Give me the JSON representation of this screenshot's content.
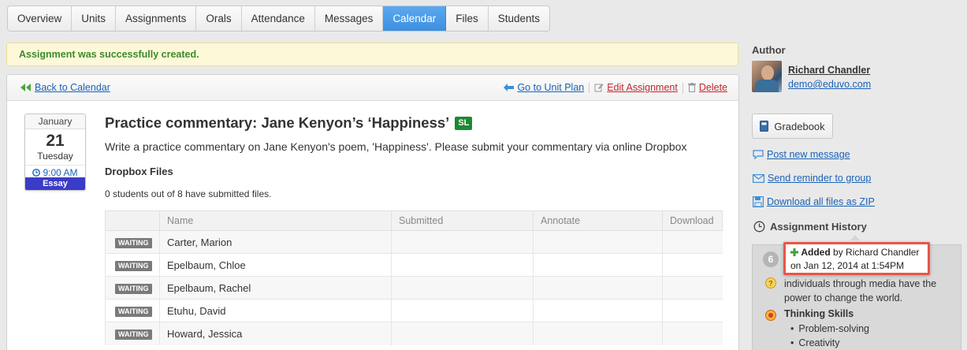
{
  "tabs": [
    "Overview",
    "Units",
    "Assignments",
    "Orals",
    "Attendance",
    "Messages",
    "Calendar",
    "Files",
    "Students"
  ],
  "active_tab": "Calendar",
  "flash": "Assignment was successfully created.",
  "panel": {
    "back_label": "Back to Calendar",
    "go_unit_plan": "Go to Unit Plan",
    "edit_assignment": "Edit Assignment",
    "delete": "Delete"
  },
  "calendar": {
    "month": "January",
    "day": "21",
    "weekday": "Tuesday",
    "time": "9:00 AM",
    "type": "Essay"
  },
  "assignment": {
    "title": "Practice commentary: Jane Kenyon’s ‘Happiness’",
    "level_badge": "SL",
    "description": "Write a practice commentary on Jane Kenyon's poem, 'Happiness'. Please submit your commentary via online Dropbox",
    "dropbox_heading": "Dropbox Files",
    "submission_count": "0 students out of 8 have submitted files."
  },
  "table": {
    "headers": [
      "",
      "Name",
      "Submitted",
      "Annotate",
      "Download"
    ],
    "rows": [
      {
        "status": "WAITING",
        "name": "Carter, Marion"
      },
      {
        "status": "WAITING",
        "name": "Epelbaum, Chloe"
      },
      {
        "status": "WAITING",
        "name": "Epelbaum, Rachel"
      },
      {
        "status": "WAITING",
        "name": "Etuhu, David"
      },
      {
        "status": "WAITING",
        "name": "Howard, Jessica"
      }
    ]
  },
  "sidebar": {
    "author_label": "Author",
    "author_name": "Richard Chandler",
    "author_email": "demo@eduvo.com",
    "gradebook": "Gradebook",
    "post_message": "Post new message",
    "send_reminder": "Send reminder to group",
    "download_zip": "Download all files as ZIP",
    "history_title": "Assignment History",
    "history_count": "6",
    "history_text": "individuals through media have the power to change the world.",
    "thinking_skills": "Thinking Skills",
    "skills": [
      "Problem-solving",
      "Creativity"
    ]
  },
  "tooltip": {
    "action": "Added",
    "by_text": "by Richard Chandler",
    "date_text": "on Jan 12, 2014 at 1:54PM"
  },
  "colors": {
    "accent": "#3d8fe0",
    "link": "#1a62b8",
    "delete": "#c4272c",
    "success": "#3d8a2b",
    "badge_sl": "#1c8a2e",
    "essay": "#3b3bc9",
    "highlight_border": "#e8564a"
  }
}
